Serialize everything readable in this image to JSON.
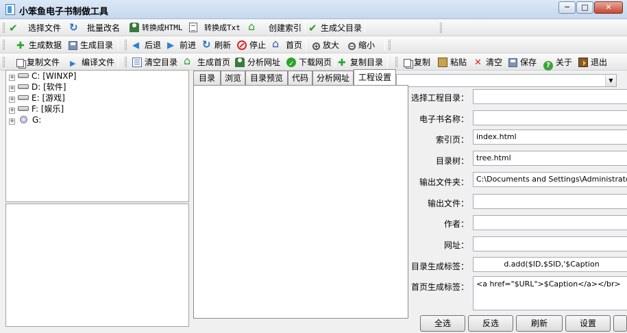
{
  "window": {
    "title": "小笨鱼电子书制做工具",
    "minimize": "─",
    "maximize": "□",
    "close": "✕"
  },
  "toolbar1": {
    "select_file": "选择文件",
    "batch_rename": "批量改名",
    "to_html": "转换成HTML",
    "to_txt": "转换成Txt",
    "create_index": "创建索引",
    "gen_parent_dir": "生成父目录"
  },
  "toolbar2": {
    "gen_data": "生成数据",
    "gen_toc": "生成目录",
    "back": "后退",
    "forward": "前进",
    "refresh": "刷新",
    "stop": "停止",
    "home": "首页",
    "zoom_in": "放大",
    "zoom_out": "缩小"
  },
  "toolbar3": {
    "copy_file": "复制文件",
    "compile_file": "编译文件",
    "clear_toc": "清空目录",
    "gen_homepage": "生成首页",
    "analyze_url": "分析网址",
    "download_page": "下载网页",
    "copy_toc": "复制目录",
    "copy": "复制",
    "paste": "粘贴",
    "clear": "清空",
    "save": "保存",
    "about": "关于",
    "exit": "退出"
  },
  "tree": {
    "items": [
      {
        "label": "C: [WINXP]"
      },
      {
        "label": "D: [软件]"
      },
      {
        "label": "E: [游戏]"
      },
      {
        "label": "F: [娱乐]"
      },
      {
        "label": "G:"
      }
    ]
  },
  "tabs": [
    {
      "label": "目录"
    },
    {
      "label": "浏览"
    },
    {
      "label": "目录预览"
    },
    {
      "label": "代码"
    },
    {
      "label": "分析网址"
    },
    {
      "label": "工程设置",
      "active": true
    }
  ],
  "form": {
    "project_dir_label": "选择工程目录：",
    "project_dir_value": "",
    "book_name_label": "电子书名称：",
    "book_name_value": "",
    "index_page_label": "索引页：",
    "index_page_value": "index.html",
    "toc_tree_label": "目录树：",
    "toc_tree_value": "tree.html",
    "output_folder_label": "输出文件夹：",
    "output_folder_value": "C:\\Documents and Settings\\Administrator\\桌",
    "output_file_label": "输出文件：",
    "output_file_value": "",
    "author_label": "作者：",
    "author_value": "",
    "url_label": "网址：",
    "url_value": "",
    "toc_tag_label": "目录生成标签：",
    "toc_tag_value": "d.add($ID,$SID,'$Caption",
    "home_tag_label": "首页生成标签：",
    "home_tag_value": "<a href=\"$URL\">$Caption</a></br>"
  },
  "buttons": {
    "select_all": "全选",
    "invert": "反选",
    "refresh": "刷新",
    "settings": "设置"
  }
}
